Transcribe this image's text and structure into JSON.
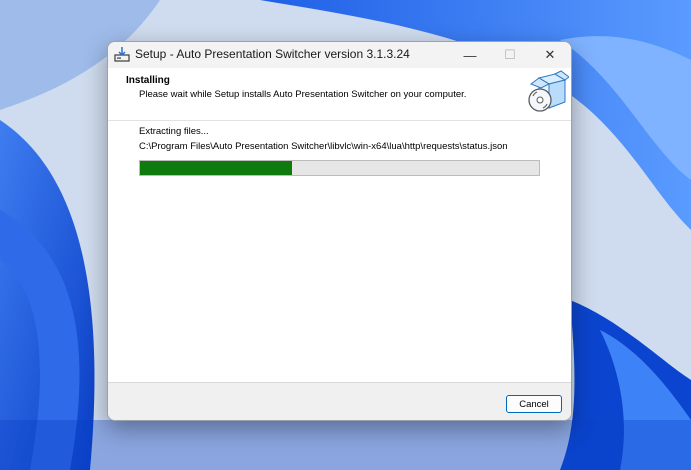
{
  "window": {
    "title": "Setup - Auto Presentation Switcher version 3.1.3.24",
    "minimize_glyph": "—",
    "maximize_glyph": "☐",
    "close_glyph": "✕"
  },
  "header": {
    "title": "Installing",
    "subtitle": "Please wait while Setup installs Auto Presentation Switcher on your computer."
  },
  "progress": {
    "status": "Extracting files...",
    "current_file": "C:\\Program Files\\Auto Presentation Switcher\\libvlc\\win-x64\\lua\\http\\requests\\status.json",
    "fraction": 0.38,
    "color": "#0f7b0f"
  },
  "footer": {
    "cancel_label": "Cancel"
  },
  "icons": {
    "app": "installer-icon",
    "header": "setup-box-cd-icon"
  },
  "colors": {
    "accent": "#0067c0",
    "progress_green": "#0f7b0f"
  }
}
